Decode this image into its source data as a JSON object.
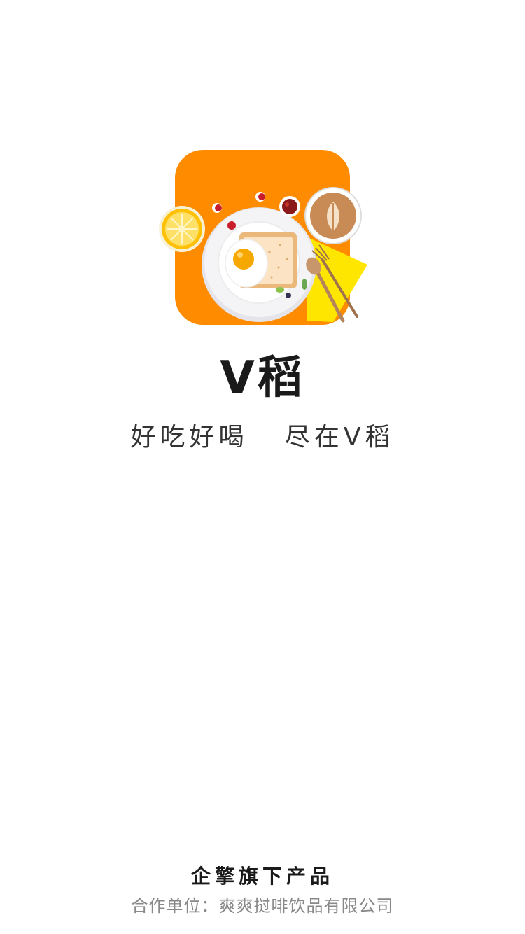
{
  "app": {
    "name": "V稻",
    "slogan": "好吃好喝   尽在V稻",
    "logo_icon": "breakfast-plate-logo-icon"
  },
  "footer": {
    "brand": "企擎旗下产品",
    "partner": "合作单位：爽爽挝啡饮品有限公司"
  },
  "colors": {
    "background": "#ffffff",
    "logo_orange": "#ff8c00",
    "napkin_yellow": "#ffe600",
    "title_text": "#1a1a1a",
    "slogan_text": "#333333",
    "partner_text": "#888888"
  }
}
